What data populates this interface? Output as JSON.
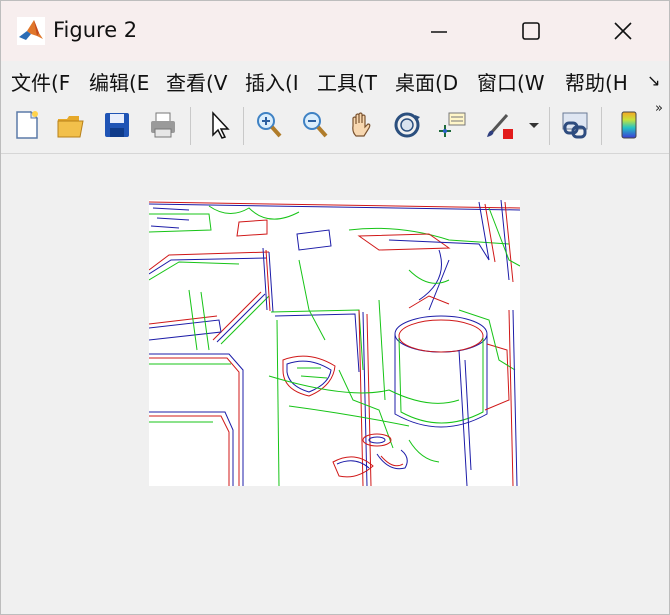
{
  "window": {
    "title": "Figure 2",
    "controls": [
      "minimize",
      "maximize",
      "close"
    ]
  },
  "menu": [
    {
      "label": "文件(F"
    },
    {
      "label": "编辑(E"
    },
    {
      "label": "查看(V"
    },
    {
      "label": "插入(I"
    },
    {
      "label": "工具(T"
    },
    {
      "label": "桌面(D"
    },
    {
      "label": "窗口(W"
    },
    {
      "label": "帮助(H"
    }
  ],
  "menu_overflow": "↘",
  "toolbar": {
    "items": [
      "new-figure-icon",
      "open-file-icon",
      "save-icon",
      "print-icon",
      "select-arrow-icon",
      "zoom-in-icon",
      "zoom-out-icon",
      "pan-hand-icon",
      "rotate-3d-icon",
      "data-cursor-icon",
      "brush-icon",
      "brush-dropdown-icon",
      "link-plot-icon",
      "colorbar-icon"
    ],
    "overflow": "»"
  },
  "figure": {
    "content": "edge detection image (white background, red/green/blue edge lines)"
  }
}
